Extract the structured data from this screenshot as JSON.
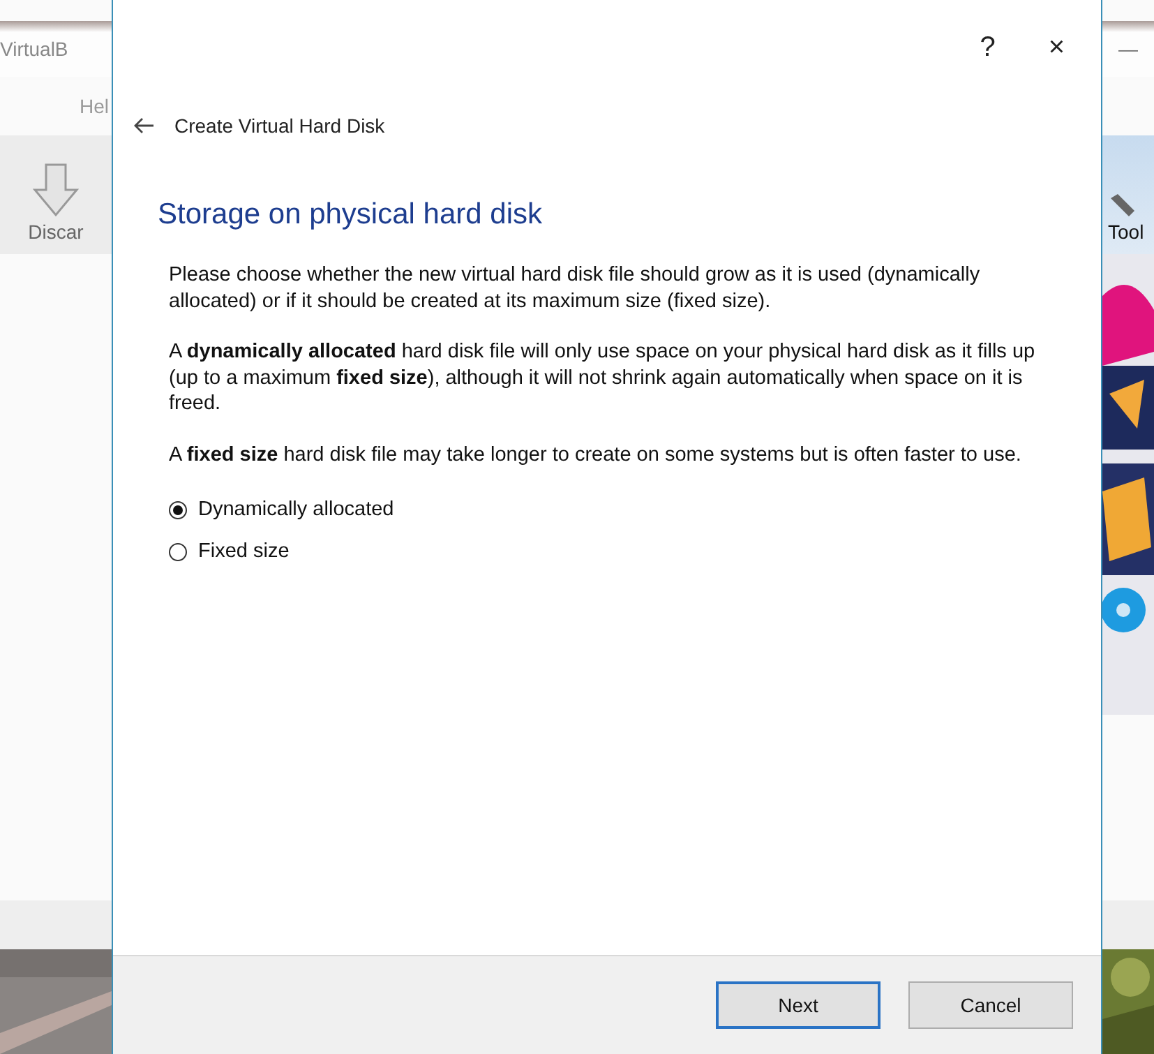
{
  "background_window": {
    "title": "VirtualB",
    "menu_item": "Hel",
    "toolbar_left": "Discar",
    "toolbar_right": "Tool",
    "minimize": "—"
  },
  "dialog": {
    "help": "?",
    "close": "×",
    "header": "Create Virtual Hard Disk",
    "heading": "Storage on physical hard disk",
    "paragraphs": [
      "Please choose whether the new virtual hard disk file should grow as it is used (dynamically allocated) or if it should be created at its maximum size (fixed size).",
      "A **dynamically allocated** hard disk file will only use space on your physical hard disk as it fills up (up to a maximum **fixed size**), although it will not shrink again automatically when space on it is freed.",
      "A **fixed size** hard disk file may take longer to create on some systems but is often faster to use."
    ],
    "options": [
      {
        "label": "Dynamically allocated",
        "selected": true
      },
      {
        "label": "Fixed size",
        "selected": false
      }
    ],
    "buttons": [
      {
        "label": "Next",
        "default": true
      },
      {
        "label": "Cancel",
        "default": false
      }
    ]
  }
}
